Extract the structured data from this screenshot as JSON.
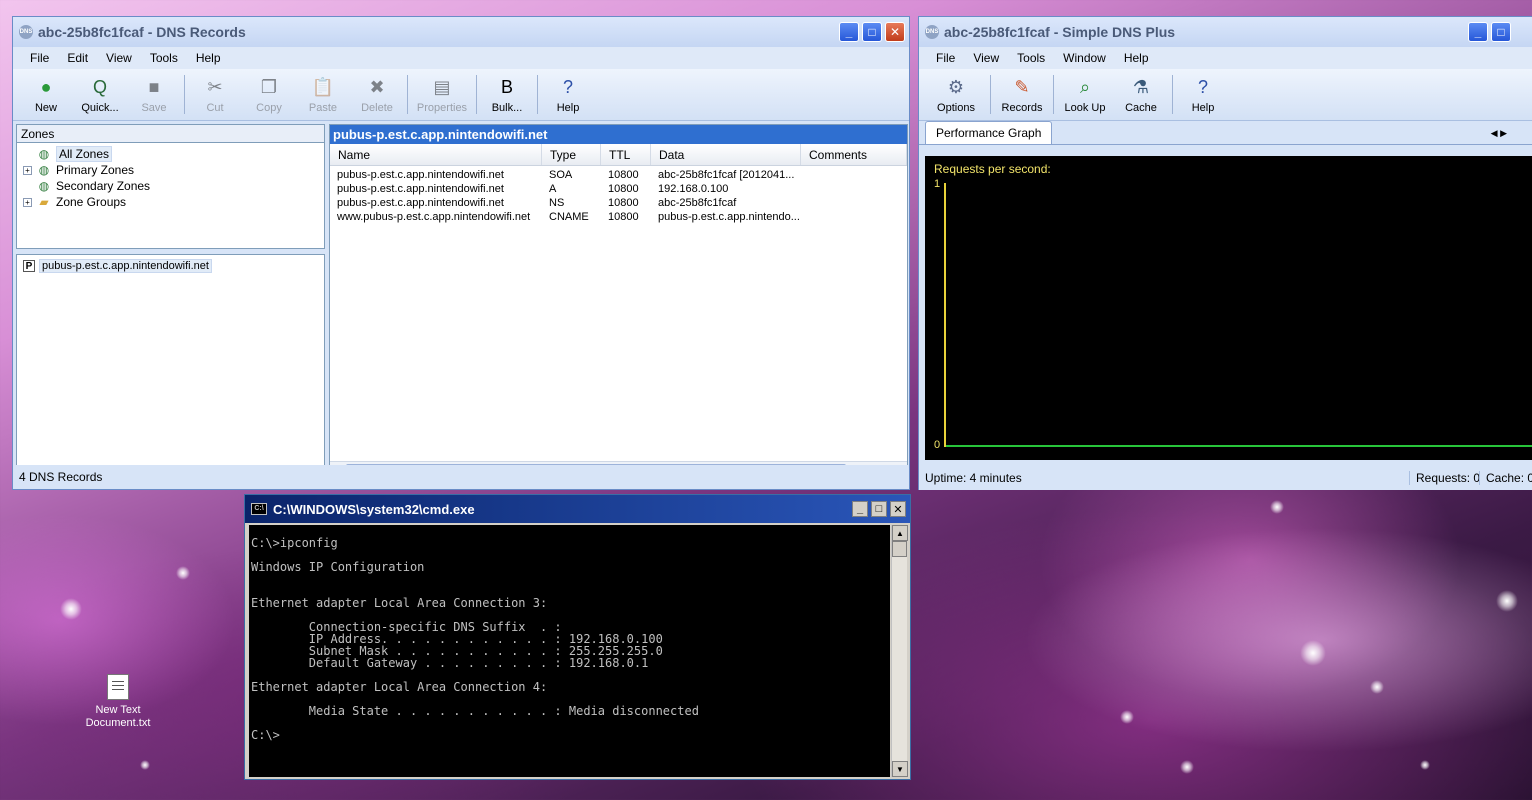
{
  "dns_records_window": {
    "title": "abc-25b8fc1fcaf - DNS Records",
    "menu": [
      "File",
      "Edit",
      "View",
      "Tools",
      "Help"
    ],
    "toolbar": {
      "new": "New",
      "quick": "Quick...",
      "save": "Save",
      "cut": "Cut",
      "copy": "Copy",
      "paste": "Paste",
      "delete": "Delete",
      "properties": "Properties",
      "bulk": "Bulk...",
      "help": "Help"
    },
    "zones_header": "Zones",
    "tree": {
      "all_zones": "All Zones",
      "primary_zones": "Primary Zones",
      "secondary_zones": "Secondary Zones",
      "zone_groups": "Zone Groups"
    },
    "selected_zone": "pubus-p.est.c.app.nintendowifi.net",
    "records_header": "pubus-p.est.c.app.nintendowifi.net",
    "columns": {
      "name": "Name",
      "type": "Type",
      "ttl": "TTL",
      "data": "Data",
      "comments": "Comments"
    },
    "records": [
      {
        "name": "pubus-p.est.c.app.nintendowifi.net",
        "type": "SOA",
        "ttl": "10800",
        "data": "abc-25b8fc1fcaf [2012041...",
        "comments": ""
      },
      {
        "name": "pubus-p.est.c.app.nintendowifi.net",
        "type": "A",
        "ttl": "10800",
        "data": "192.168.0.100",
        "comments": ""
      },
      {
        "name": "pubus-p.est.c.app.nintendowifi.net",
        "type": "NS",
        "ttl": "10800",
        "data": "abc-25b8fc1fcaf",
        "comments": ""
      },
      {
        "name": "www.pubus-p.est.c.app.nintendowifi.net",
        "type": "CNAME",
        "ttl": "10800",
        "data": "pubus-p.est.c.app.nintendo...",
        "comments": ""
      }
    ],
    "status": "4 DNS Records"
  },
  "simple_dns_window": {
    "title": "abc-25b8fc1fcaf - Simple DNS Plus",
    "menu": [
      "File",
      "View",
      "Tools",
      "Window",
      "Help"
    ],
    "toolbar": {
      "options": "Options",
      "records": "Records",
      "lookup": "Look Up",
      "cache": "Cache",
      "help": "Help"
    },
    "tab": "Performance Graph",
    "graph": {
      "label": "Requests per second:",
      "ymax": "1",
      "ymin": "0"
    },
    "status": {
      "uptime": "Uptime: 4 minutes",
      "requests": "Requests: 0",
      "cache": "Cache: 0"
    }
  },
  "cmd_window": {
    "title": "C:\\WINDOWS\\system32\\cmd.exe",
    "lines": [
      "C:\\>ipconfig",
      "",
      "Windows IP Configuration",
      "",
      "",
      "Ethernet adapter Local Area Connection 3:",
      "",
      "        Connection-specific DNS Suffix  . :",
      "        IP Address. . . . . . . . . . . . : 192.168.0.100",
      "        Subnet Mask . . . . . . . . . . . : 255.255.255.0",
      "        Default Gateway . . . . . . . . . : 192.168.0.1",
      "",
      "Ethernet adapter Local Area Connection 4:",
      "",
      "        Media State . . . . . . . . . . . : Media disconnected",
      "",
      "C:\\>"
    ]
  },
  "desktop": {
    "icon_label": "New Text Document.txt"
  }
}
